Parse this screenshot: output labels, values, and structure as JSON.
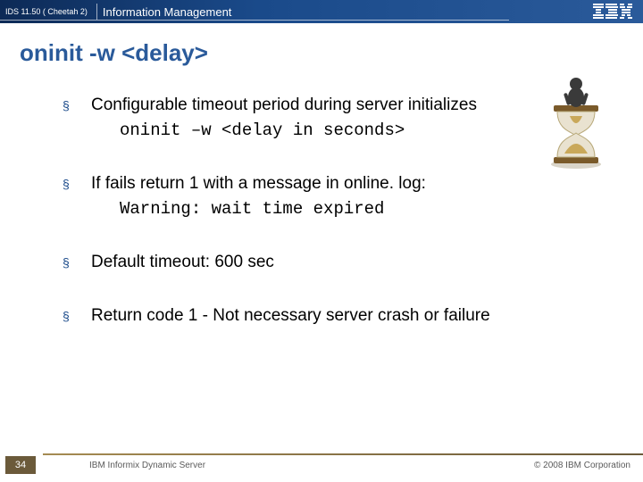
{
  "header": {
    "product_tag": "IDS 11.50 ( Cheetah 2)",
    "section": "Information Management",
    "logo_name": "ibm-logo"
  },
  "title": "oninit -w <delay>",
  "bullets": [
    {
      "text": "Configurable timeout period during server initializes",
      "code": "oninit –w <delay in seconds>"
    },
    {
      "text": "If fails return 1 with a message in online. log:",
      "code": "Warning: wait time expired"
    },
    {
      "text": "Default timeout: 600 sec",
      "code": ""
    },
    {
      "text": "Return code 1 - Not necessary server crash or failure",
      "code": ""
    }
  ],
  "footer": {
    "slide_number": "34",
    "product": "IBM Informix Dynamic Server",
    "copyright": "© 2008 IBM Corporation"
  },
  "image": {
    "alt": "figure sitting on hourglass"
  }
}
